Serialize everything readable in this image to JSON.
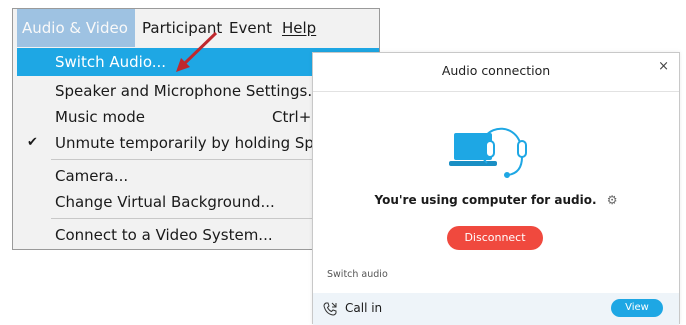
{
  "menubar": {
    "items": [
      {
        "label": "Audio & Video"
      },
      {
        "label": "Participant"
      },
      {
        "label": "Event"
      },
      {
        "label": "Help"
      }
    ]
  },
  "dropdown": {
    "items": [
      {
        "label": "Switch Audio...",
        "highlighted": true
      },
      {
        "label": "Speaker and Microphone Settings..."
      },
      {
        "label": "Music mode",
        "shortcut": "Ctrl+S"
      },
      {
        "label": "Unmute temporarily by holding Spac",
        "checked": true
      },
      {
        "label": "Camera..."
      },
      {
        "label": "Change Virtual Background..."
      },
      {
        "label": "Connect to a Video System..."
      }
    ]
  },
  "dialog": {
    "title": "Audio connection",
    "close_glyph": "×",
    "status_text": "You're using computer for audio.",
    "disconnect_label": "Disconnect",
    "switch_audio_label": "Switch audio",
    "call_in_label": "Call in",
    "view_label": "View"
  },
  "icons": {
    "check": "check-icon",
    "gear": "gear-icon",
    "phone": "phone-icon",
    "arrow": "arrow-annotation",
    "illustration": "computer-headset-icon"
  },
  "colors": {
    "highlight": "#1ea7e4",
    "disconnect": "#f0493e",
    "arrow": "#c0282d",
    "callin_bg": "#eef4f9"
  }
}
